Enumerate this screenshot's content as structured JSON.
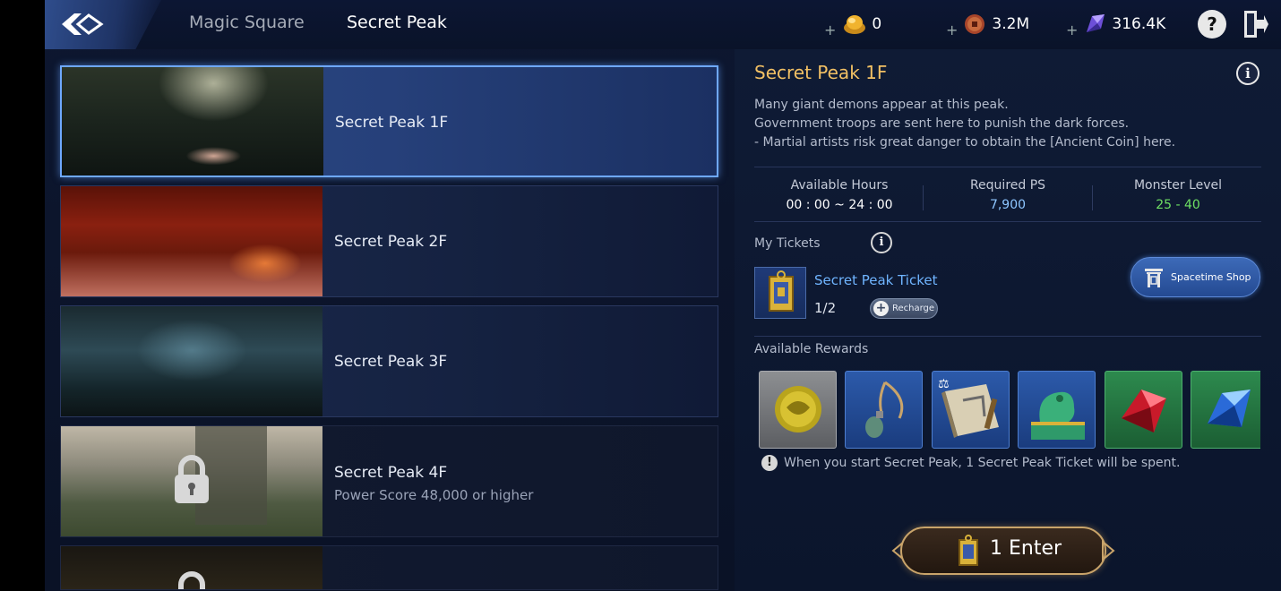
{
  "header": {
    "tabs": [
      {
        "label": "Magic Square"
      },
      {
        "label": "Secret Peak"
      }
    ],
    "currencies": [
      {
        "icon": "gold-ingot-icon",
        "value": "0"
      },
      {
        "icon": "copper-coin-icon",
        "value": "3.2M"
      },
      {
        "icon": "crystal-icon",
        "value": "316.4K"
      }
    ],
    "help_label": "?"
  },
  "floors": [
    {
      "name": "Secret Peak 1F",
      "requirement": "",
      "locked": false,
      "selected": true
    },
    {
      "name": "Secret Peak 2F",
      "requirement": "",
      "locked": false,
      "selected": false
    },
    {
      "name": "Secret Peak 3F",
      "requirement": "",
      "locked": false,
      "selected": false
    },
    {
      "name": "Secret Peak 4F",
      "requirement": "Power Score 48,000 or higher",
      "locked": true,
      "selected": false
    }
  ],
  "detail": {
    "title": "Secret Peak 1F",
    "description": [
      "Many giant demons appear at this peak.",
      "Government troops are sent here to punish the dark forces.",
      "- Martial artists risk great danger to obtain the [Ancient Coin] here."
    ],
    "stats": [
      {
        "label": "Available Hours",
        "value": "00 : 00 ~ 24 : 00"
      },
      {
        "label": "Required PS",
        "value": "7,900"
      },
      {
        "label": "Monster Level",
        "value": "25 - 40"
      }
    ],
    "tickets_label": "My Tickets",
    "ticket": {
      "name": "Secret Peak Ticket",
      "count": "1/2",
      "recharge_label": "Recharge"
    },
    "shop_label": "Spacetime Shop",
    "rewards_label": "Available Rewards",
    "rewards": [
      {
        "icon": "ancient-coin-icon"
      },
      {
        "icon": "pendant-icon"
      },
      {
        "icon": "skill-book-icon"
      },
      {
        "icon": "jade-dragon-seal-icon"
      },
      {
        "icon": "red-crystal-icon"
      },
      {
        "icon": "blue-crystal-icon"
      }
    ],
    "warning": "When you start Secret Peak, 1 Secret Peak Ticket will be spent.",
    "enter_count": "1",
    "enter_label": "Enter"
  },
  "colors": {
    "title_gold": "#f2c064",
    "ticket_blue": "#6fb4ff",
    "ps_blue": "#8ec6ff",
    "level_green": "#6ee063"
  }
}
